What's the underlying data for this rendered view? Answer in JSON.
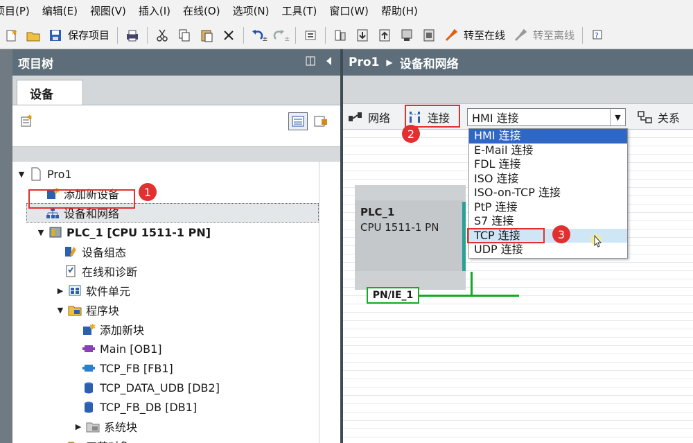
{
  "menubar": [
    "项目(P)",
    "编辑(E)",
    "视图(V)",
    "插入(I)",
    "在线(O)",
    "选项(N)",
    "工具(T)",
    "窗口(W)",
    "帮助(H)"
  ],
  "toolbar": {
    "save_project": "保存项目",
    "go_online": "转至在线",
    "go_offline": "转至离线"
  },
  "tree": {
    "title": "项目树",
    "tab": "设备",
    "items": [
      {
        "label": "Pro1",
        "icon": "project-icon"
      },
      {
        "label": "添加新设备",
        "icon": "add-device-icon"
      },
      {
        "label": "设备和网络",
        "icon": "network-icon"
      },
      {
        "label": "PLC_1 [CPU 1511-1 PN]",
        "icon": "plc-icon"
      },
      {
        "label": "设备组态",
        "icon": "device-config-icon"
      },
      {
        "label": "在线和诊断",
        "icon": "diagnostics-icon"
      },
      {
        "label": "软件单元",
        "icon": "software-unit-icon"
      },
      {
        "label": "程序块",
        "icon": "folder-icon"
      },
      {
        "label": "添加新块",
        "icon": "add-block-icon"
      },
      {
        "label": "Main [OB1]",
        "icon": "ob-icon"
      },
      {
        "label": "TCP_FB [FB1]",
        "icon": "fb-icon"
      },
      {
        "label": "TCP_DATA_UDB [DB2]",
        "icon": "db-icon"
      },
      {
        "label": "TCP_FB_DB [DB1]",
        "icon": "db-icon"
      },
      {
        "label": "系统块",
        "icon": "system-block-icon"
      },
      {
        "label": "工艺对象",
        "icon": "technology-object-icon"
      }
    ]
  },
  "editor": {
    "breadcrumb_project": "Pro1",
    "breadcrumb_page": "设备和网络",
    "network_btn": "网络",
    "connections_btn": "连接",
    "connection_type_selected": "HMI 连接",
    "relations_btn": "关系",
    "connection_options": [
      "HMI 连接",
      "E-Mail 连接",
      "FDL 连接",
      "ISO 连接",
      "ISO-on-TCP 连接",
      "PtP 连接",
      "S7 连接",
      "TCP 连接",
      "UDP 连接"
    ],
    "plc_name": "PLC_1",
    "plc_type": "CPU 1511-1 PN",
    "network_name": "PN/IE_1"
  },
  "callouts": [
    "1",
    "2",
    "3"
  ],
  "colors": {
    "header": "#5d6e7a",
    "selection": "#2f67c5",
    "network": "#11aa22",
    "callout": "#e03030"
  }
}
